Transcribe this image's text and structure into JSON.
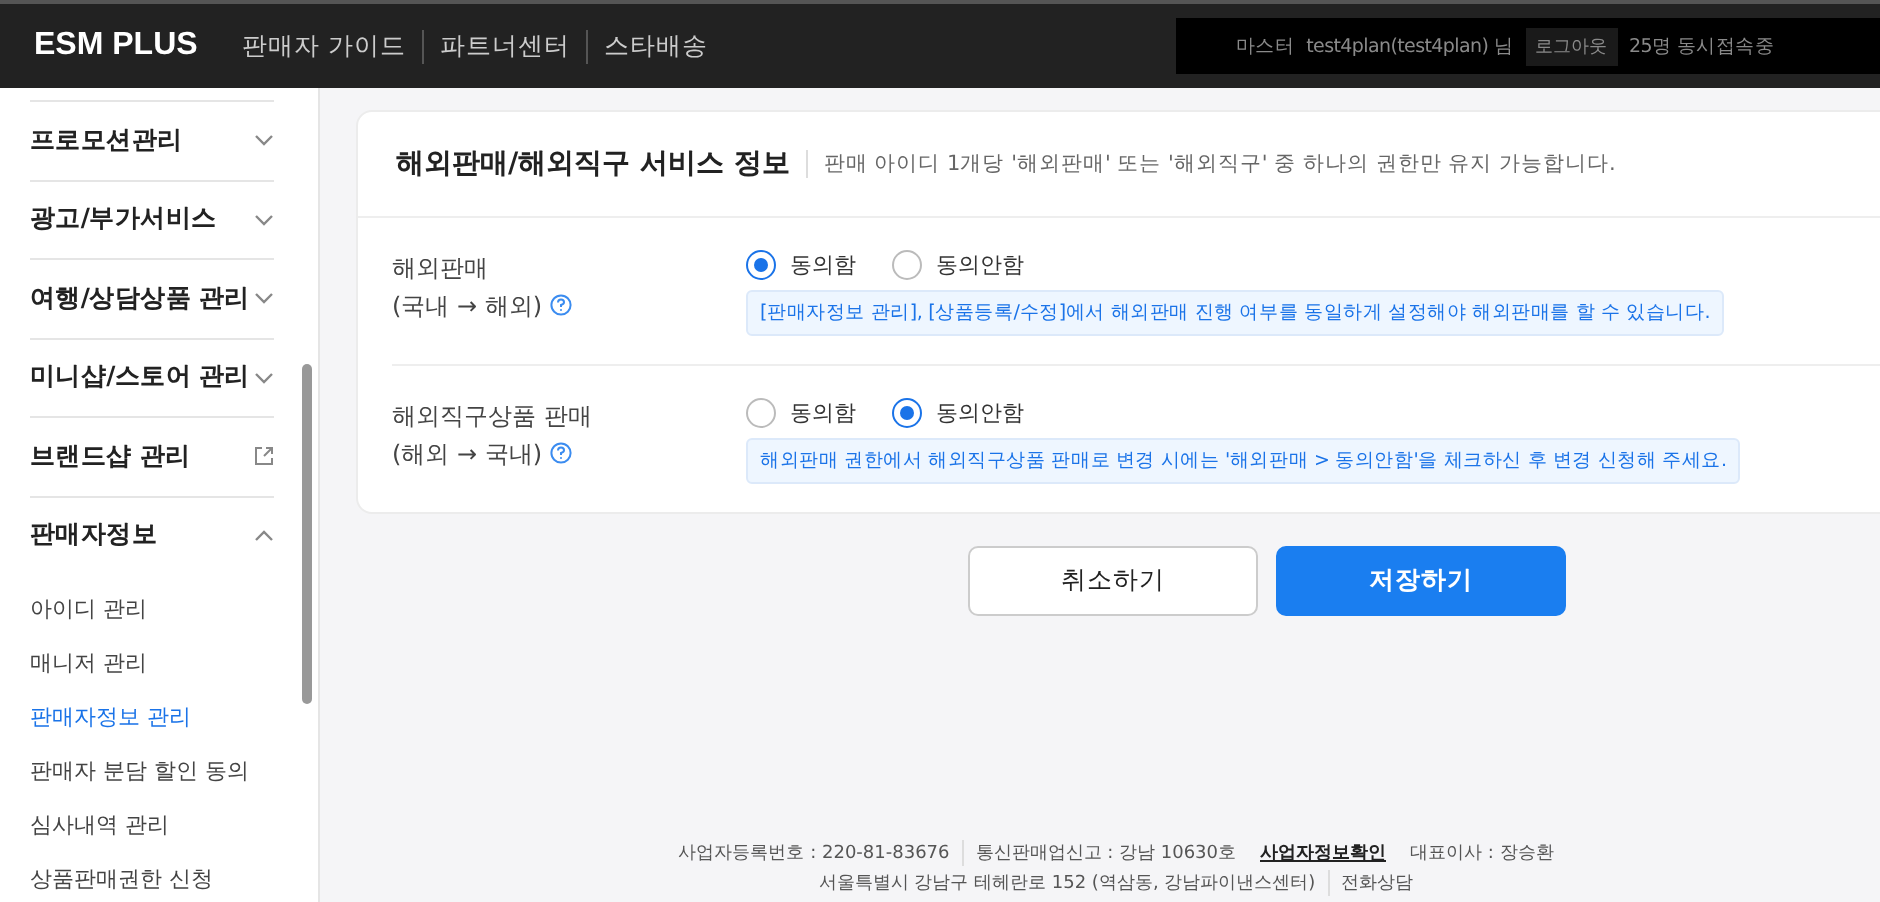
{
  "header": {
    "logo": "ESM PLUS",
    "nav": [
      "판매자 가이드",
      "파트너센터",
      "스타배송"
    ],
    "user": {
      "badge": "마스터",
      "name": "test4plan(test4plan) 님",
      "logout": "로그아웃",
      "online": "25명 동시접속중"
    }
  },
  "sidebar": {
    "items": [
      {
        "label": "프로모션관리",
        "kind": "accordion",
        "expanded": false
      },
      {
        "label": "광고/부가서비스",
        "kind": "accordion",
        "expanded": false
      },
      {
        "label": "여행/상담상품 관리",
        "kind": "accordion",
        "expanded": false
      },
      {
        "label": "미니샵/스토어 관리",
        "kind": "accordion",
        "expanded": false
      },
      {
        "label": "브랜드샵 관리",
        "kind": "external"
      },
      {
        "label": "판매자정보",
        "kind": "accordion",
        "expanded": true,
        "children": [
          {
            "label": "아이디 관리",
            "selected": false
          },
          {
            "label": "매니저 관리",
            "selected": false
          },
          {
            "label": "판매자정보 관리",
            "selected": true
          },
          {
            "label": "판매자 분담 할인 동의",
            "selected": false
          },
          {
            "label": "심사내역 관리",
            "selected": false
          },
          {
            "label": "상품판매권한 신청",
            "selected": false
          }
        ]
      }
    ]
  },
  "card": {
    "title": "해외판매/해외직구 서비스 정보",
    "note": "판매 아이디 1개당 '해외판매' 또는 '해외직구' 중 하나의 권한만 유지 가능합니다.",
    "rows": [
      {
        "label": [
          "해외판매",
          "(국내 → 해외)"
        ],
        "options": [
          {
            "label": "동의함",
            "selected": true
          },
          {
            "label": "동의안함",
            "selected": false
          }
        ],
        "info": "[판매자정보 관리], [상품등록/수정]에서 해외판매 진행 여부를 동일하게 설정해야 해외판매를 할 수 있습니다."
      },
      {
        "label": [
          "해외직구상품 판매",
          "(해외 → 국내)"
        ],
        "options": [
          {
            "label": "동의함",
            "selected": false
          },
          {
            "label": "동의안함",
            "selected": true
          }
        ],
        "info": "해외판매 권한에서 해외직구상품 판매로 변경 시에는 '해외판매 > 동의안함'을 체크하신 후 변경 신청해 주세요."
      }
    ]
  },
  "buttons": [
    {
      "label": "취소하기",
      "kind": "secondary"
    },
    {
      "label": "저장하기",
      "kind": "primary"
    }
  ],
  "footer": {
    "lines": [
      [
        {
          "text": "사업자등록번호 : 220-81-83676",
          "kind": "text"
        },
        {
          "text": "통신판매업신고 : 강남 10630호",
          "kind": "text"
        },
        {
          "text": "사업자정보확인",
          "kind": "link"
        },
        {
          "text": "대표이사 : 장승환",
          "kind": "text"
        }
      ],
      [
        {
          "text": "서울특별시 강남구 테헤란로 152 (역삼동, 강남파이낸스센터)",
          "kind": "text"
        },
        {
          "text": "전화상담",
          "kind": "text"
        }
      ]
    ]
  }
}
